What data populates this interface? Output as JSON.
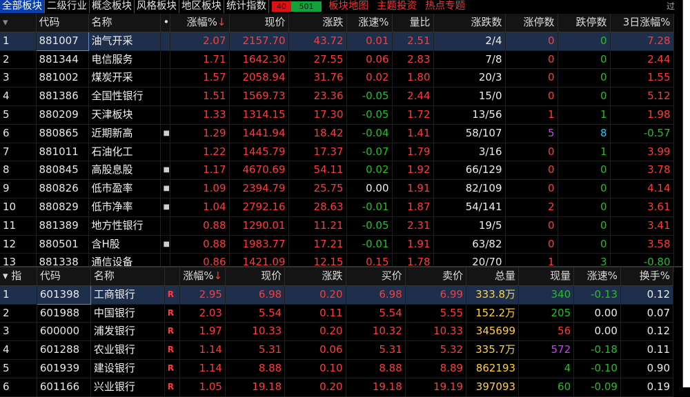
{
  "tabs": [
    {
      "label": "全部板块",
      "active": true
    },
    {
      "label": "二级行业"
    },
    {
      "label": "概念板块"
    },
    {
      "label": "风格板块"
    },
    {
      "label": "地区板块"
    },
    {
      "label": "统计指数"
    }
  ],
  "ratio": {
    "up": "40",
    "down": "501"
  },
  "extra_tabs": [
    "板块地图",
    "主题投资",
    "热点专题"
  ],
  "corner_text": "过",
  "sector_table": {
    "headers": {
      "code": "代码",
      "name": "名称",
      "dot": "•",
      "chg_pct": "涨幅%",
      "sort_arrow": "↓",
      "price": "现价",
      "chg": "涨跌",
      "speed": "涨速%",
      "vol_ratio": "量比",
      "up_down": "涨跌数",
      "limit_up": "涨停数",
      "limit_down": "跌停数",
      "chg3d": "3日涨幅%"
    },
    "rows": [
      {
        "idx": "1",
        "code": "881007",
        "name": "油气开采",
        "dot": "",
        "chg_pct": "2.07",
        "price": "2157.70",
        "chg": "43.72",
        "speed": "0.01",
        "vol_ratio": "2.51",
        "up_down": "2/4",
        "limit_up": "0",
        "limit_down": "0",
        "chg3d": "7.28",
        "speed_color": "red",
        "chg3d_color": "red",
        "lu_color": "red",
        "ld_color": "green",
        "selected": true
      },
      {
        "idx": "2",
        "code": "881344",
        "name": "电信服务",
        "dot": "",
        "chg_pct": "1.71",
        "price": "1642.30",
        "chg": "27.55",
        "speed": "0.06",
        "vol_ratio": "2.83",
        "up_down": "7/8",
        "limit_up": "0",
        "limit_down": "0",
        "chg3d": "2.44",
        "speed_color": "red",
        "chg3d_color": "red",
        "lu_color": "red",
        "ld_color": "green"
      },
      {
        "idx": "3",
        "code": "881002",
        "name": "煤炭开采",
        "dot": "",
        "chg_pct": "1.57",
        "price": "2058.94",
        "chg": "31.76",
        "speed": "0.02",
        "vol_ratio": "1.80",
        "up_down": "20/3",
        "limit_up": "0",
        "limit_down": "0",
        "chg3d": "1.55",
        "speed_color": "red",
        "chg3d_color": "red",
        "lu_color": "red",
        "ld_color": "green"
      },
      {
        "idx": "4",
        "code": "881386",
        "name": "全国性银行",
        "dot": "",
        "chg_pct": "1.51",
        "price": "1569.73",
        "chg": "23.36",
        "speed": "-0.05",
        "vol_ratio": "2.44",
        "up_down": "15/0",
        "limit_up": "0",
        "limit_down": "0",
        "chg3d": "5.12",
        "speed_color": "green",
        "chg3d_color": "red",
        "lu_color": "red",
        "ld_color": "green"
      },
      {
        "idx": "5",
        "code": "880209",
        "name": "天津板块",
        "dot": "",
        "chg_pct": "1.33",
        "price": "1314.15",
        "chg": "17.30",
        "speed": "-0.05",
        "vol_ratio": "1.72",
        "up_down": "13/56",
        "limit_up": "1",
        "limit_down": "1",
        "chg3d": "1.98",
        "speed_color": "green",
        "chg3d_color": "red",
        "lu_color": "red",
        "ld_color": "green"
      },
      {
        "idx": "6",
        "code": "880865",
        "name": "近期新高",
        "dot": "■",
        "chg_pct": "1.29",
        "price": "1441.94",
        "chg": "18.42",
        "speed": "-0.04",
        "vol_ratio": "1.41",
        "up_down": "58/107",
        "limit_up": "5",
        "limit_down": "8",
        "chg3d": "-0.57",
        "speed_color": "green",
        "chg3d_color": "green",
        "lu_color": "magenta",
        "ld_color": "cyan"
      },
      {
        "idx": "7",
        "code": "881011",
        "name": "石油化工",
        "dot": "",
        "chg_pct": "1.22",
        "price": "1445.79",
        "chg": "17.37",
        "speed": "-0.07",
        "vol_ratio": "1.79",
        "up_down": "3/16",
        "limit_up": "0",
        "limit_down": "1",
        "chg3d": "3.99",
        "speed_color": "green",
        "chg3d_color": "red",
        "lu_color": "red",
        "ld_color": "green"
      },
      {
        "idx": "8",
        "code": "880845",
        "name": "高股息股",
        "dot": "■",
        "chg_pct": "1.17",
        "price": "4670.69",
        "chg": "54.11",
        "speed": "0.02",
        "vol_ratio": "1.92",
        "up_down": "66/129",
        "limit_up": "0",
        "limit_down": "0",
        "chg3d": "3.78",
        "speed_color": "green",
        "chg3d_color": "red",
        "lu_color": "red",
        "ld_color": "green"
      },
      {
        "idx": "9",
        "code": "880826",
        "name": "低市盈率",
        "dot": "■",
        "chg_pct": "1.09",
        "price": "2394.79",
        "chg": "25.75",
        "speed": "0.00",
        "vol_ratio": "1.91",
        "up_down": "82/109",
        "limit_up": "0",
        "limit_down": "0",
        "chg3d": "4.14",
        "speed_color": "white",
        "chg3d_color": "red",
        "lu_color": "red",
        "ld_color": "green"
      },
      {
        "idx": "10",
        "code": "880829",
        "name": "低市净率",
        "dot": "■",
        "chg_pct": "1.04",
        "price": "2792.16",
        "chg": "28.63",
        "speed": "-0.01",
        "vol_ratio": "1.87",
        "up_down": "54/141",
        "limit_up": "2",
        "limit_down": "0",
        "chg3d": "3.61",
        "speed_color": "green",
        "chg3d_color": "red",
        "lu_color": "red",
        "ld_color": "green"
      },
      {
        "idx": "11",
        "code": "881389",
        "name": "地方性银行",
        "dot": "",
        "chg_pct": "0.88",
        "price": "1290.01",
        "chg": "11.21",
        "speed": "-0.05",
        "vol_ratio": "2.31",
        "up_down": "19/5",
        "limit_up": "0",
        "limit_down": "0",
        "chg3d": "3.41",
        "speed_color": "green",
        "chg3d_color": "red",
        "lu_color": "red",
        "ld_color": "green"
      },
      {
        "idx": "12",
        "code": "880501",
        "name": "含H股",
        "dot": "■",
        "chg_pct": "0.88",
        "price": "1983.77",
        "chg": "17.21",
        "speed": "-0.01",
        "vol_ratio": "1.91",
        "up_down": "63/82",
        "limit_up": "0",
        "limit_down": "0",
        "chg3d": "3.58",
        "speed_color": "green",
        "chg3d_color": "red",
        "lu_color": "red",
        "ld_color": "green"
      },
      {
        "idx": "13",
        "code": "881338",
        "name": "通信设备",
        "dot": "",
        "chg_pct": "0.86",
        "price": "1421.09",
        "chg": "12.15",
        "speed": "0.15",
        "vol_ratio": "1.78",
        "up_down": "20/70",
        "limit_up": "1",
        "limit_down": "3",
        "chg3d": "-0.80",
        "speed_color": "red",
        "chg3d_color": "green",
        "lu_color": "red",
        "ld_color": "green"
      }
    ]
  },
  "stock_table": {
    "headers": {
      "idx": "▾ 指",
      "code": "代码",
      "name": "名称",
      "chg_pct": "涨幅%",
      "sort_arrow": "↓",
      "price": "现价",
      "chg": "涨跌",
      "bid": "买价",
      "ask": "卖价",
      "total_vol": "总量",
      "cur_vol": "现量",
      "speed": "涨速%",
      "turnover": "换手%"
    },
    "rows": [
      {
        "idx": "1",
        "code": "601398",
        "name": "工商银行",
        "mark": "R",
        "chg_pct": "2.95",
        "price": "6.98",
        "chg": "0.20",
        "bid": "6.98",
        "ask": "6.99",
        "total_vol": "333.8万",
        "cur_vol": "340",
        "speed": "-0.13",
        "turnover": "0.12",
        "cur_color": "green",
        "speed_color": "green",
        "selected": true
      },
      {
        "idx": "2",
        "code": "601988",
        "name": "中国银行",
        "mark": "R",
        "chg_pct": "2.03",
        "price": "5.54",
        "chg": "0.11",
        "bid": "5.54",
        "ask": "5.55",
        "total_vol": "152.2万",
        "cur_vol": "205",
        "speed": "0.00",
        "turnover": "0.07",
        "cur_color": "green",
        "speed_color": "white"
      },
      {
        "idx": "3",
        "code": "600000",
        "name": "浦发银行",
        "mark": "R",
        "chg_pct": "1.97",
        "price": "10.33",
        "chg": "0.20",
        "bid": "10.32",
        "ask": "10.33",
        "total_vol": "345699",
        "cur_vol": "56",
        "speed": "0.00",
        "turnover": "0.12",
        "cur_color": "red",
        "speed_color": "white"
      },
      {
        "idx": "4",
        "code": "601288",
        "name": "农业银行",
        "mark": "R",
        "chg_pct": "1.14",
        "price": "5.31",
        "chg": "0.06",
        "bid": "5.31",
        "ask": "5.32",
        "total_vol": "335.7万",
        "cur_vol": "572",
        "speed": "-0.18",
        "turnover": "0.11",
        "cur_color": "magenta",
        "speed_color": "green"
      },
      {
        "idx": "5",
        "code": "601939",
        "name": "建设银行",
        "mark": "R",
        "chg_pct": "1.14",
        "price": "8.88",
        "chg": "0.10",
        "bid": "8.88",
        "ask": "8.89",
        "total_vol": "862193",
        "cur_vol": "4",
        "speed": "-0.10",
        "turnover": "0.90",
        "cur_color": "green",
        "speed_color": "green"
      },
      {
        "idx": "6",
        "code": "601166",
        "name": "兴业银行",
        "mark": "R",
        "chg_pct": "1.05",
        "price": "19.18",
        "chg": "0.20",
        "bid": "19.18",
        "ask": "19.19",
        "total_vol": "397093",
        "cur_vol": "60",
        "speed": "-0.09",
        "turnover": "0.19",
        "cur_color": "green",
        "speed_color": "green"
      }
    ]
  },
  "colors": {
    "up": "#ff3b3b",
    "down": "#21c021",
    "active_tab": "#0b3ea8",
    "volume": "#ffd23c"
  }
}
